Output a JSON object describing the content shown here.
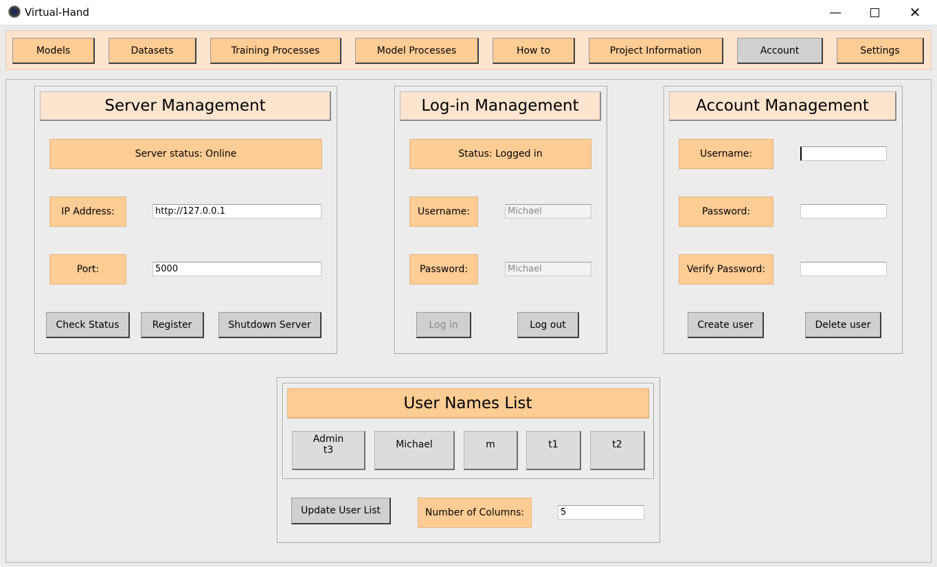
{
  "window": {
    "title": "Virtual-Hand"
  },
  "nav": [
    {
      "label": "Models"
    },
    {
      "label": "Datasets"
    },
    {
      "label": "Training Processes"
    },
    {
      "label": "Model Processes"
    },
    {
      "label": "How to"
    },
    {
      "label": "Project Information"
    },
    {
      "label": "Account",
      "active": true
    },
    {
      "label": "Settings"
    }
  ],
  "server": {
    "title": "Server Management",
    "status": "Server status: Online",
    "ip_label": "IP Address:",
    "ip_value": "http://127.0.0.1",
    "port_label": "Port:",
    "port_value": "5000",
    "check_status": "Check Status",
    "register": "Register",
    "shutdown": "Shutdown Server"
  },
  "login": {
    "title": "Log-in Management",
    "status": "Status: Logged in",
    "username_label": "Username:",
    "username_value": "Michael",
    "password_label": "Password:",
    "password_value": "Michael",
    "login_btn": "Log in",
    "logout_btn": "Log out"
  },
  "account": {
    "title": "Account Management",
    "username_label": "Username:",
    "username_value": "",
    "password_label": "Password:",
    "password_value": "",
    "verify_label": "Verify Password:",
    "verify_value": "",
    "create_btn": "Create user",
    "delete_btn": "Delete user"
  },
  "users": {
    "title": "User Names List",
    "cells": [
      "Admin\nt3",
      "Michael",
      "m",
      "t1",
      "t2"
    ],
    "update_btn": "Update User List",
    "columns_label": "Number of Columns:",
    "columns_value": "5"
  },
  "colors": {
    "accent_orange": "#fecc95",
    "status_green": "#bcdf95",
    "header_peach": "#fde4cf"
  }
}
